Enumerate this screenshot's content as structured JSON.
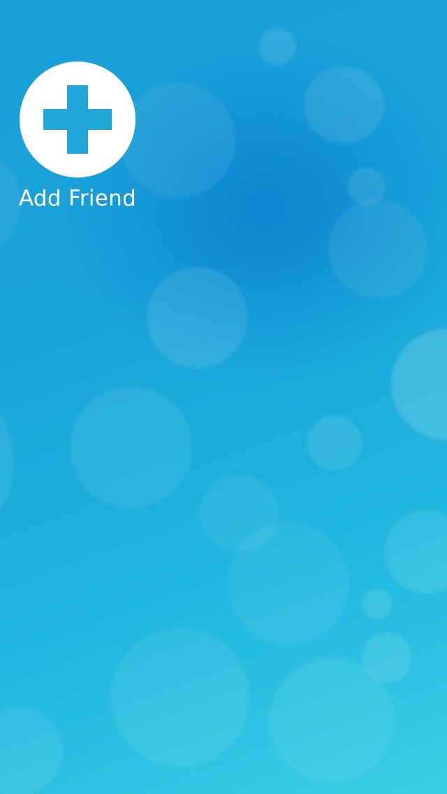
{
  "screen": {
    "background_colors": [
      "#1a9fd8",
      "#20b6df",
      "#3bcde6"
    ],
    "accent_color": "#22a6d9"
  },
  "add_friend": {
    "icon": "plus-icon",
    "label": "Add Friend"
  }
}
